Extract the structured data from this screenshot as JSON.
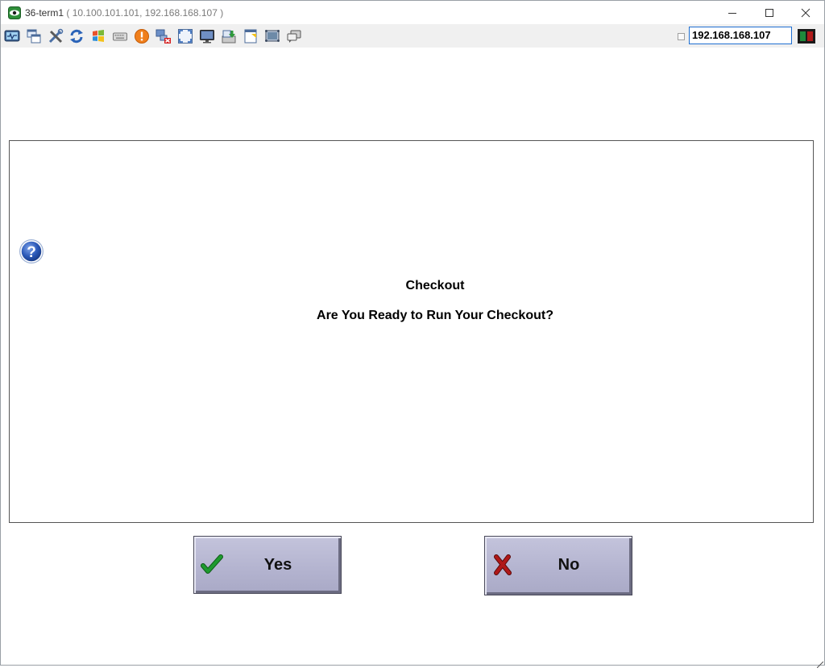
{
  "window": {
    "title_name": "36-term1",
    "title_addresses": " ( 10.100.101.101, 192.168.168.107 )"
  },
  "toolbar": {
    "icons": [
      "monitor-activity-icon",
      "windows-cascade-icon",
      "tools-icon",
      "refresh-icon",
      "windows-logo-icon",
      "keyboard-icon",
      "alert-icon",
      "network-disconnect-icon",
      "fullscreen-icon",
      "display-icon",
      "download-icon",
      "note-icon",
      "screen-capture-icon",
      "chat-icon"
    ],
    "ip_value": "192.168.168.107",
    "status_colors": {
      "left": "#1f8a3c",
      "right": "#b01a1a"
    }
  },
  "dialog": {
    "title": "Checkout",
    "message": "Are You Ready to Run Your Checkout?"
  },
  "buttons": {
    "yes_label": "Yes",
    "no_label": "No"
  },
  "colors": {
    "button_face": "#b3b3cf",
    "check_green": "#1e9a2e",
    "cross_red": "#b01818",
    "help_blue": "#2b59b8"
  }
}
